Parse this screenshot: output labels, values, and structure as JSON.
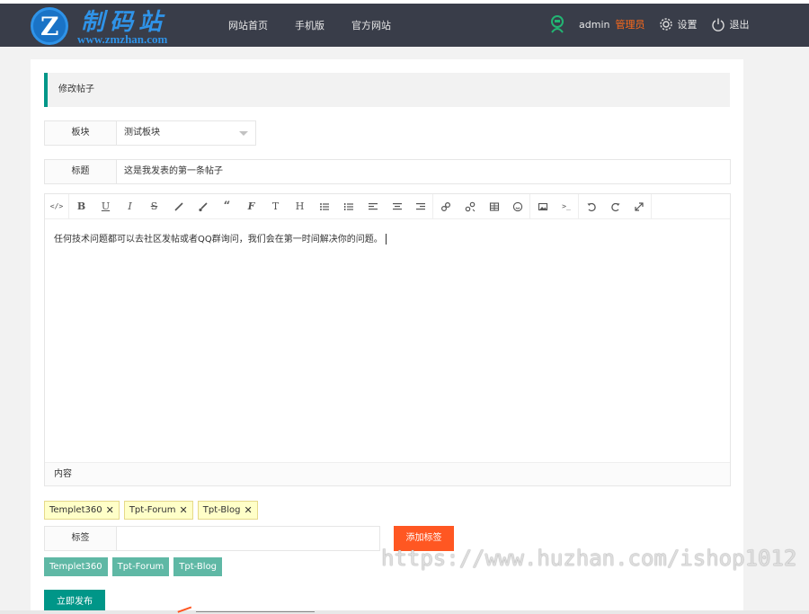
{
  "header": {
    "logo_cn": "制码站",
    "logo_en": "www.zmzhan.com",
    "nav": [
      "网站首页",
      "手机版",
      "官方网站"
    ],
    "user": "admin",
    "role": "管理员",
    "settings": "设置",
    "logout": "退出"
  },
  "page": {
    "title": "修改帖子"
  },
  "form": {
    "board_label": "板块",
    "board_value": "测试板块",
    "title_label": "标题",
    "title_value": "这是我发表的第一条帖子",
    "content_text": "任何技术问题都可以去社区发帖或者QQ群询问，我们会在第一时间解决你的问题。",
    "content_label": "内容",
    "tag_label": "标签",
    "tag_input_value": "",
    "add_tag": "添加标签",
    "publish": "立即发布"
  },
  "tags_selected": [
    "Templet360",
    "Tpt-Forum",
    "Tpt-Blog"
  ],
  "tags_available": [
    "Templet360",
    "Tpt-Forum",
    "Tpt-Blog"
  ],
  "remove_glyph": "✕",
  "toolbar_glyphs": {
    "code": "</>",
    "bold": "B",
    "underline": "U",
    "italic": "I",
    "strike": "S",
    "font": "F",
    "size": "T",
    "heading": "H"
  },
  "watermark": "https://www.huzhan.com/ishop1012",
  "colors": {
    "header": "#393d49",
    "accent": "#009688",
    "orange": "#ff5722",
    "tag_bg": "#ffffc8"
  }
}
